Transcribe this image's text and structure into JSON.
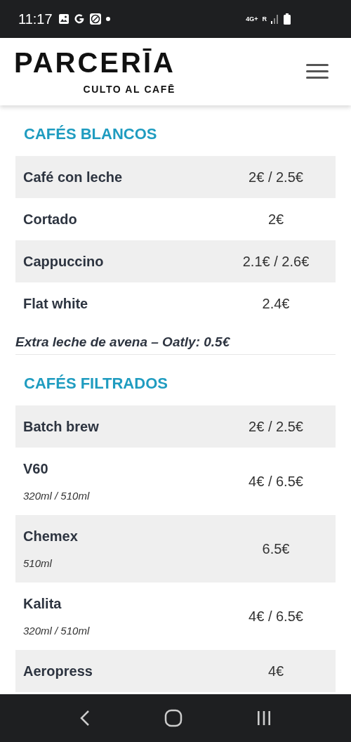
{
  "status_bar": {
    "time": "11:17",
    "network": "4G+",
    "roaming": "R"
  },
  "header": {
    "logo": "PARCERĪA",
    "tagline": "CULTO AL CAFĒ"
  },
  "sections": [
    {
      "title": "CAFÉS BLANCOS",
      "rows": [
        {
          "name": "Café con leche",
          "price": "2€ / 2.5€"
        },
        {
          "name": "Cortado",
          "price": "2€"
        },
        {
          "name": "Cappuccino",
          "price": "2.1€ / 2.6€"
        },
        {
          "name": "Flat white",
          "price": "2.4€"
        }
      ],
      "note": "Extra leche de avena – Oatly: 0.5€"
    },
    {
      "title": "CAFÉS FILTRADOS",
      "rows": [
        {
          "name": "Batch brew",
          "price": "2€ / 2.5€"
        },
        {
          "name": "V60",
          "size": "320ml / 510ml",
          "price": "4€ / 6.5€"
        },
        {
          "name": "Chemex",
          "size": "510ml",
          "price": "6.5€"
        },
        {
          "name": "Kalita",
          "size": "320ml / 510ml",
          "price": "4€ / 6.5€"
        },
        {
          "name": "Aeropress",
          "price": "4€"
        }
      ]
    }
  ]
}
